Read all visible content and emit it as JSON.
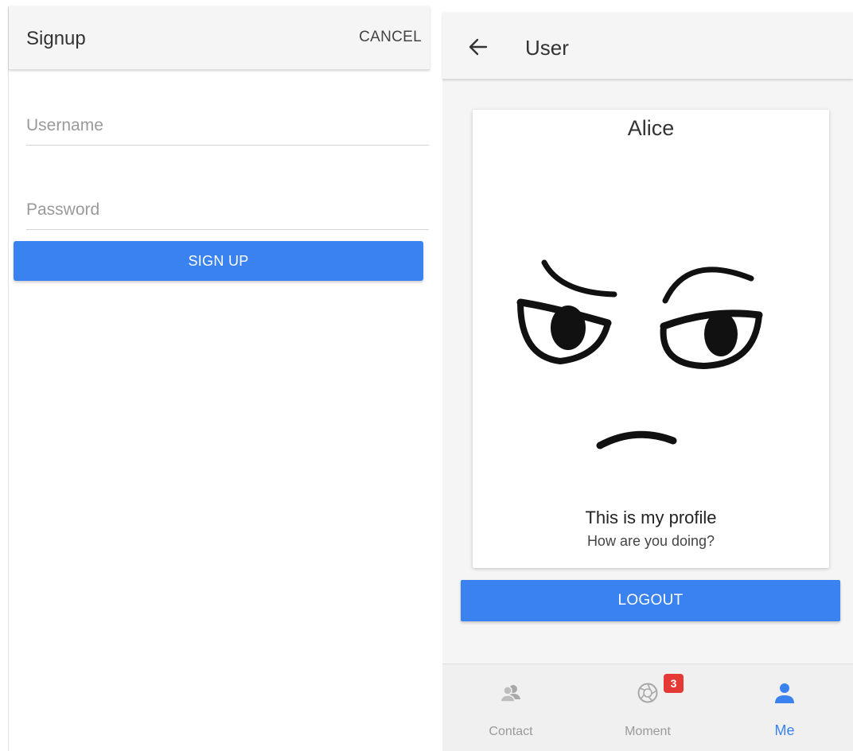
{
  "signup": {
    "title": "Signup",
    "cancel_label": "CANCEL",
    "username_placeholder": "Username",
    "password_placeholder": "Password",
    "signup_label": "SIGN UP"
  },
  "user": {
    "title": "User",
    "back_icon": "arrow-left-icon",
    "profile": {
      "name": "Alice",
      "line1": "This is my profile",
      "line2": "How are you doing?"
    },
    "logout_label": "LOGOUT"
  },
  "tabbar": {
    "tabs": [
      {
        "label": "Contact",
        "icon": "contacts-icon",
        "active": false
      },
      {
        "label": "Moment",
        "icon": "aperture-icon",
        "active": false,
        "badge": "3"
      },
      {
        "label": "Me",
        "icon": "person-icon",
        "active": true
      }
    ]
  },
  "colors": {
    "accent": "#3a82f0",
    "badge": "#e53935",
    "header_bg": "#f5f5f5"
  }
}
